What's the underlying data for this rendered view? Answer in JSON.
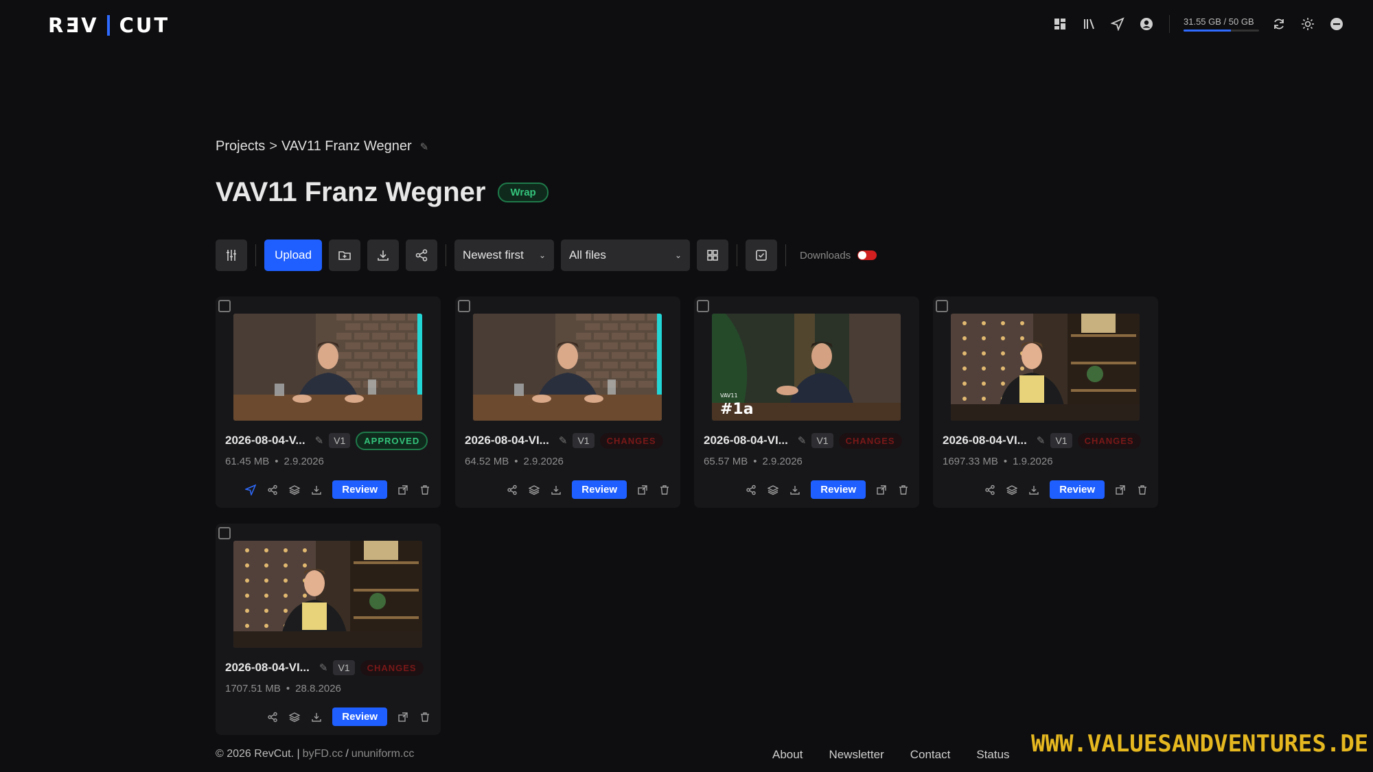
{
  "header": {
    "logo_left": "RƎV",
    "logo_right": "CUT",
    "storage_text": "31.55 GB / 50 GB",
    "storage_fraction": 0.631
  },
  "breadcrumb": {
    "root": "Projects",
    "separator": ">",
    "current": "VAV11 Franz Wegner"
  },
  "page": {
    "title": "VAV11 Franz Wegner",
    "badge": "Wrap"
  },
  "toolbar": {
    "upload_label": "Upload",
    "sort_value": "Newest first",
    "filter_value": "All files",
    "downloads_label": "Downloads",
    "downloads_enabled": false
  },
  "cards": [
    {
      "name": "2026-08-04-V...",
      "version": "V1",
      "status": "APPROVED",
      "size": "61.45 MB",
      "date": "2.9.2026",
      "review_label": "Review",
      "scene": "brick",
      "has_sent_icon": true
    },
    {
      "name": "2026-08-04-VI...",
      "version": "V1",
      "status": "CHANGES",
      "size": "64.52 MB",
      "date": "2.9.2026",
      "review_label": "Review",
      "scene": "brick",
      "has_sent_icon": false
    },
    {
      "name": "2026-08-04-VI...",
      "version": "V1",
      "status": "CHANGES",
      "size": "65.57 MB",
      "date": "2.9.2026",
      "review_label": "Review",
      "scene": "plant",
      "overlay_text": "#1a",
      "overlay_small": "VAV11",
      "has_sent_icon": false
    },
    {
      "name": "2026-08-04-VI...",
      "version": "V1",
      "status": "CHANGES",
      "size": "1697.33 MB",
      "date": "1.9.2026",
      "review_label": "Review",
      "scene": "shelf",
      "has_sent_icon": false
    },
    {
      "name": "2026-08-04-VI...",
      "version": "V1",
      "status": "CHANGES",
      "size": "1707.51 MB",
      "date": "28.8.2026",
      "review_label": "Review",
      "scene": "shelf",
      "has_sent_icon": false
    }
  ],
  "footer": {
    "copyright": "© 2026 RevCut. |",
    "credit_1": "byFD.cc",
    "credit_sep": "/",
    "credit_2": "ununiform.cc",
    "links": [
      "About",
      "Newsletter",
      "Contact",
      "Status"
    ]
  },
  "watermark": {
    "text": "WWW.VALUESANDVENTURES.DE"
  },
  "colors": {
    "accent": "#1f5fff",
    "approved": "#34c47c",
    "changes": "#7a1818",
    "background": "#0e0e10"
  }
}
